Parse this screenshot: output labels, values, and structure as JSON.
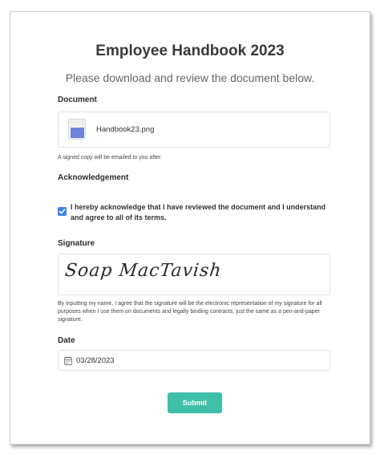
{
  "page": {
    "title": "Employee Handbook 2023",
    "subtitle": "Please download and review the document below."
  },
  "document": {
    "label": "Document",
    "file_name": "Handbook23.png",
    "file_icon": "image-file-icon",
    "note": "A signed copy will be emailed to you after."
  },
  "acknowledgement": {
    "label": "Acknowledgement",
    "checked": true,
    "text": "I hereby acknowledge that I have reviewed the document and I understand and agree to all of its terms.",
    "checkbox_color": "#3f83e6"
  },
  "signature": {
    "label": "Signature",
    "value": "Soap MacTavish",
    "note": "By inputting my name, I agree that the signature will be the electronic representation of my signature for all purposes when I use them on documents and legally binding contracts, just the same as a pen-and-paper signature."
  },
  "date": {
    "label": "Date",
    "value": "03/28/2023",
    "icon": "calendar-icon"
  },
  "submit": {
    "label": "Submit",
    "color": "#3fbfa8"
  }
}
